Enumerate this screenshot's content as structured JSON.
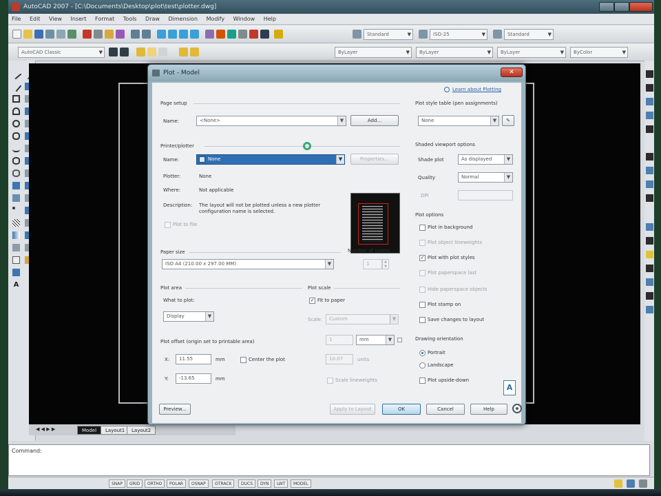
{
  "app": {
    "title": "AutoCAD 2007 - [C:\\Documents\\Desktop\\plot\\test\\plotter.dwg]",
    "menu": [
      "File",
      "Edit",
      "View",
      "Insert",
      "Format",
      "Tools",
      "Draw",
      "Dimension",
      "Modify",
      "Window",
      "Help"
    ],
    "workspace_combo": "AutoCAD Classic",
    "style_combo": "Standard",
    "dimstyle_combo": "ISO-25",
    "tablestyle_combo": "Standard",
    "layer_combo": "ByLayer",
    "linetype_combo": "ByLayer",
    "lineweight_combo": "ByLayer",
    "plotstyle_combo": "ByColor"
  },
  "layout_tabs": [
    "Model",
    "Layout1",
    "Layout2"
  ],
  "command": {
    "prompt": "Command:"
  },
  "status_buttons": [
    "SNAP",
    "GRID",
    "ORTHO",
    "POLAR",
    "OSNAP",
    "OTRACK",
    "DUCS",
    "DYN",
    "LWT",
    "MODEL"
  ],
  "dialog": {
    "title": "Plot - Model",
    "learn_link": "Learn about Plotting",
    "page_setup": {
      "heading": "Page setup",
      "name_label": "Name:",
      "name_value": "<None>",
      "add_button": "Add..."
    },
    "printer": {
      "heading": "Printer/plotter",
      "name_label": "Name:",
      "name_value": "None",
      "properties_button": "Properties...",
      "plotter_label": "Plotter:",
      "plotter_value": "None",
      "where_label": "Where:",
      "where_value": "Not applicable",
      "description_label": "Description:",
      "description_value": "The layout will not be plotted unless a new plotter configuration name is selected.",
      "plot_to_file_label": "Plot to file"
    },
    "paper_size": {
      "heading": "Paper size",
      "value": "ISO A4 (210.00 x 297.00 MM)"
    },
    "copies": {
      "heading": "Number of copies",
      "value": "1"
    },
    "plot_area": {
      "heading": "Plot area",
      "what_label": "What to plot:",
      "what_value": "Display"
    },
    "plot_scale": {
      "heading": "Plot scale",
      "fit_label": "Fit to paper",
      "scale_label": "Scale:",
      "scale_value": "Custom",
      "num_value": "1",
      "unit_value": "mm",
      "den_value": "10.07",
      "den_unit": "units",
      "lineweights_label": "Scale lineweights"
    },
    "plot_offset": {
      "heading": "Plot offset (origin set to printable area)",
      "x_label": "X:",
      "x_value": "11.55",
      "y_label": "Y:",
      "y_value": "-13.65",
      "unit": "mm",
      "center_label": "Center the plot"
    },
    "plot_style_table": {
      "heading": "Plot style table (pen assignments)",
      "value": "None"
    },
    "shaded": {
      "heading": "Shaded viewport options",
      "shade_label": "Shade plot",
      "shade_value": "As displayed",
      "quality_label": "Quality",
      "quality_value": "Normal",
      "dpi_label": "DPI"
    },
    "plot_options": {
      "heading": "Plot options",
      "items": [
        {
          "label": "Plot in background",
          "checked": false,
          "enabled": true
        },
        {
          "label": "Plot object lineweights",
          "checked": false,
          "enabled": false
        },
        {
          "label": "Plot with plot styles",
          "checked": true,
          "enabled": true
        },
        {
          "label": "Plot paperspace last",
          "checked": false,
          "enabled": false
        },
        {
          "label": "Hide paperspace objects",
          "checked": false,
          "enabled": false
        },
        {
          "label": "Plot stamp on",
          "checked": false,
          "enabled": true
        },
        {
          "label": "Save changes to layout",
          "checked": false,
          "enabled": true
        }
      ]
    },
    "orientation": {
      "heading": "Drawing orientation",
      "portrait": "Portrait",
      "landscape": "Landscape",
      "upside_down": "Plot upside-down",
      "icon_letter": "A"
    },
    "buttons": {
      "preview": "Preview...",
      "apply": "Apply to Layout",
      "ok": "OK",
      "cancel": "Cancel",
      "help": "Help"
    }
  }
}
